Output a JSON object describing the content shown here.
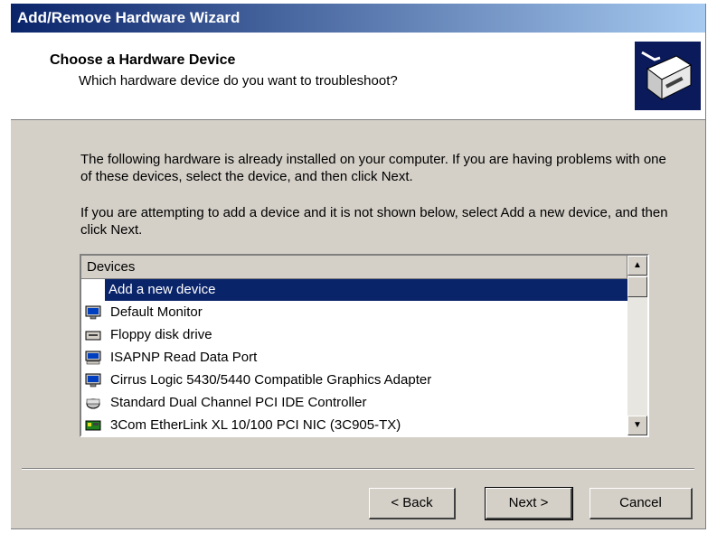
{
  "window": {
    "title": "Add/Remove Hardware Wizard"
  },
  "header": {
    "title": "Choose a Hardware Device",
    "subtitle": "Which hardware device do you want to troubleshoot?",
    "icon": "hardware-wizard-icon"
  },
  "body": {
    "paragraph1": "The following hardware is already installed on your computer. If you are having problems with one of these devices, select the device, and then click Next.",
    "paragraph2": "If you are attempting to add a device and it is not shown below, select Add a new device, and then click Next."
  },
  "devices": {
    "column_header": "Devices",
    "items": [
      {
        "label": "Add a new device",
        "icon": "none",
        "selected": true
      },
      {
        "label": "Default Monitor",
        "icon": "monitor-icon"
      },
      {
        "label": "Floppy disk drive",
        "icon": "floppy-drive-icon"
      },
      {
        "label": "ISAPNP Read Data Port",
        "icon": "computer-icon"
      },
      {
        "label": "Cirrus Logic 5430/5440 Compatible Graphics Adapter",
        "icon": "monitor-icon"
      },
      {
        "label": "Standard Dual Channel PCI IDE Controller",
        "icon": "ide-controller-icon"
      },
      {
        "label": "3Com EtherLink XL 10/100 PCI NIC (3C905-TX)",
        "icon": "network-card-icon"
      }
    ]
  },
  "buttons": {
    "back": "< Back",
    "next": "Next >",
    "cancel": "Cancel"
  },
  "colors": {
    "selection": "#0a246a",
    "face": "#d4d0c8",
    "titlebar_start": "#0a246a",
    "titlebar_end": "#a6caf0"
  }
}
